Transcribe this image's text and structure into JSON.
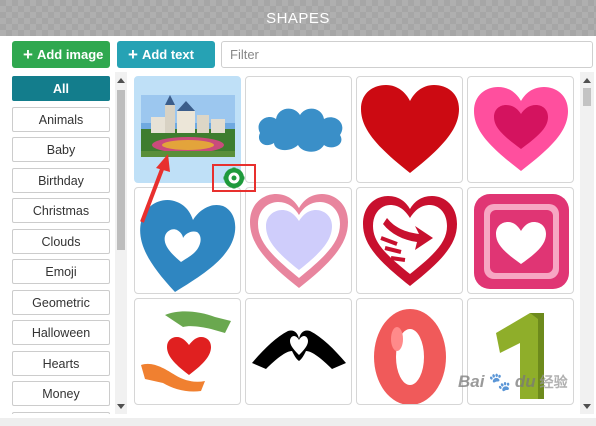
{
  "header": {
    "title": "SHAPES"
  },
  "toolbar": {
    "add_image_label": "Add image",
    "add_text_label": "Add text",
    "filter_placeholder": "Filter",
    "add_image_color": "#2fa84f",
    "add_text_color": "#26a2b4"
  },
  "categories": {
    "active": "All",
    "items": [
      {
        "label": "All"
      },
      {
        "label": "Animals"
      },
      {
        "label": "Baby"
      },
      {
        "label": "Birthday"
      },
      {
        "label": "Christmas"
      },
      {
        "label": "Clouds"
      },
      {
        "label": "Emoji"
      },
      {
        "label": "Geometric"
      },
      {
        "label": "Halloween"
      },
      {
        "label": "Hearts"
      },
      {
        "label": "Money"
      }
    ]
  },
  "shapes": [
    {
      "icon": "castle-photo-thumbnail",
      "selected": true
    },
    {
      "icon": "blue-cloud-shape"
    },
    {
      "icon": "red-heart-shape"
    },
    {
      "icon": "pink-double-heart-shape"
    },
    {
      "icon": "blue-heart-with-white-heart-shape"
    },
    {
      "icon": "pink-outline-heart-shape"
    },
    {
      "icon": "red-heart-arrow-shape"
    },
    {
      "icon": "pink-square-heart-shape"
    },
    {
      "icon": "hands-holding-heart-shape"
    },
    {
      "icon": "black-hands-heart-shape"
    },
    {
      "icon": "red-number-zero-shape"
    },
    {
      "icon": "green-number-one-shape"
    }
  ],
  "annotation": {
    "icon": "green-gear-icon",
    "highlight_color": "#e8302e"
  },
  "watermark": {
    "text": "Bai",
    "paw": "🐾",
    "text2": "du",
    "cn": "经验"
  }
}
